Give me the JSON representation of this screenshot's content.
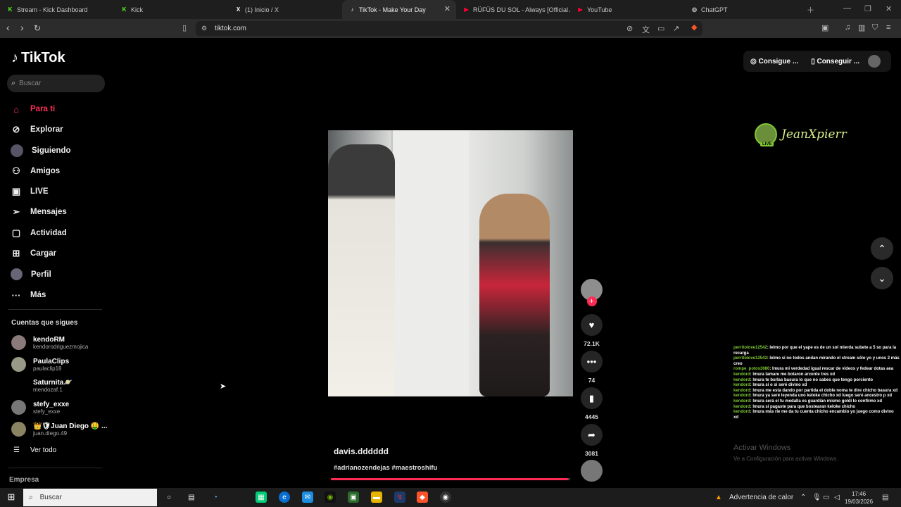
{
  "browser": {
    "tabs": [
      {
        "label": "Stream - Kick Dashboard",
        "icon": "kick-icon",
        "color": "#53fc18",
        "glyph": "K"
      },
      {
        "label": "Kick",
        "icon": "kick-icon",
        "color": "#53fc18",
        "glyph": "K"
      },
      {
        "label": "(1) Inicio / X",
        "icon": "x-icon",
        "color": "#ffffff",
        "glyph": "X"
      },
      {
        "label": "TikTok - Make Your Day",
        "icon": "tiktok-icon",
        "color": "#ffffff",
        "glyph": "♪",
        "active": true
      },
      {
        "label": "RÜFÜS DU SOL - Always [Official Au...",
        "icon": "youtube-icon",
        "color": "#ff0033",
        "glyph": "▶"
      },
      {
        "label": "YouTube",
        "icon": "youtube-icon",
        "color": "#ff0033",
        "glyph": "▶"
      },
      {
        "label": "ChatGPT",
        "icon": "chatgpt-icon",
        "color": "#dddddd",
        "glyph": "◎"
      }
    ],
    "url": "tiktok.com"
  },
  "sidebar": {
    "logo": "TikTok",
    "search_placeholder": "Buscar",
    "nav": [
      {
        "label": "Para ti",
        "icon": "home-icon",
        "active": true
      },
      {
        "label": "Explorar",
        "icon": "compass-icon"
      },
      {
        "label": "Siguiendo",
        "icon": "following-avatar-icon"
      },
      {
        "label": "Amigos",
        "icon": "friends-icon"
      },
      {
        "label": "LIVE",
        "icon": "live-icon"
      },
      {
        "label": "Mensajes",
        "icon": "messages-icon"
      },
      {
        "label": "Actividad",
        "icon": "activity-icon"
      },
      {
        "label": "Cargar",
        "icon": "upload-icon"
      },
      {
        "label": "Perfil",
        "icon": "profile-icon"
      },
      {
        "label": "Más",
        "icon": "more-icon"
      }
    ],
    "following_title": "Cuentas que sigues",
    "following": [
      {
        "name": "kendoRM",
        "handle": "kendorodriguezmojica"
      },
      {
        "name": "PaulaClips",
        "handle": "paulaclip18"
      },
      {
        "name": "Saturnita🪐",
        "handle": "mendozaf.1"
      },
      {
        "name": "stefy_exxe",
        "handle": "stefy_exxe"
      },
      {
        "name": "👑🛡Juan Diego 🤑 ...",
        "handle": "juan.diego.49"
      }
    ],
    "see_all": "Ver todo",
    "company": "Empresa"
  },
  "topbar": {
    "btn1": "Consigue ...",
    "btn2": "Conseguir ..."
  },
  "video": {
    "author": "davis.dddddd",
    "hashtags": "#adrianozendejas #maestroshifu",
    "progress": 0.99,
    "likes": "72.1K",
    "comments": "74",
    "saves": "4445",
    "shares": "3081"
  },
  "stream_overlay": {
    "streamer": "JeanXpierr",
    "live_badge": "LIVE",
    "chat": [
      {
        "user": "perritolove12542",
        "text": ": lelmo por que el yape es de un sol mierda subete a 5 so para la recarga"
      },
      {
        "user": "perritolove12542",
        "text": ": lelmo si no todos andan mirando el stream sólo yo y unos 2 más creo"
      },
      {
        "user": "rompe_potos3080",
        "text": ": lmura mi verdedad igual rescar de videos y fedear dotas aea"
      },
      {
        "user": "kendord",
        "text": ": lmura tamare me botaron arconte tres xd"
      },
      {
        "user": "kendord",
        "text": ": lmura te burlas basura lo que no sabes que tengo porciento"
      },
      {
        "user": "kendord",
        "text": ": lmura si o si seré divino xd"
      },
      {
        "user": "kendord",
        "text": ": lmura me esta dando por partida el doble noma te dire chicho basura xd"
      },
      {
        "user": "kendord",
        "text": ": lmura ya seré leyenda uno keloke chicho xd luego seré ancestro p xd"
      },
      {
        "user": "kendord",
        "text": ": lmura será el tu medalla es guardián mismo goldi lo confirmo xd"
      },
      {
        "user": "kendord",
        "text": ": lmura si pagaste para que bostearan keloke chicho"
      },
      {
        "user": "kendord",
        "text": ": lmura más ríe me da tu cuenta chicho encambio yo juego como divino xd"
      }
    ],
    "watermark_title": "Activar Windows",
    "watermark_sub": "Ve a Configuración para activar Windows."
  },
  "taskbar": {
    "search": "Buscar",
    "weather": "Advertencia de calor",
    "time": "17:46",
    "date": "19/03/2026"
  },
  "colors": {
    "accent": "#fe2c55",
    "overlay_green": "#7ec832"
  }
}
